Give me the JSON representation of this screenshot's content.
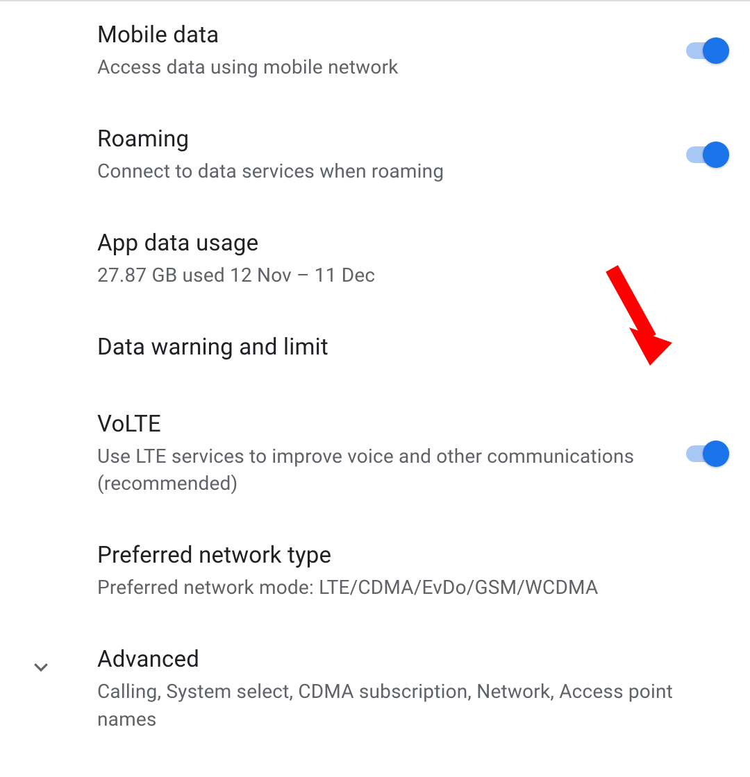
{
  "settings": {
    "mobile_data": {
      "title": "Mobile data",
      "subtitle": "Access data using mobile network",
      "enabled": true
    },
    "roaming": {
      "title": "Roaming",
      "subtitle": "Connect to data services when roaming",
      "enabled": true
    },
    "app_data_usage": {
      "title": "App data usage",
      "subtitle": "27.87 GB used 12 Nov – 11 Dec"
    },
    "data_warning_limit": {
      "title": "Data warning and limit"
    },
    "volte": {
      "title": "VoLTE",
      "subtitle": "Use LTE services to improve voice and other communications (recommended)",
      "enabled": true
    },
    "preferred_network_type": {
      "title": "Preferred network type",
      "subtitle": "Preferred network mode: LTE/CDMA/EvDo/GSM/WCDMA"
    },
    "advanced": {
      "title": "Advanced",
      "subtitle": "Calling, System select, CDMA subscription, Network, Access point names"
    }
  },
  "colors": {
    "toggle_on_track": "#a9c7f5",
    "toggle_on_thumb": "#1a73e8",
    "arrow": "#ff0000"
  }
}
